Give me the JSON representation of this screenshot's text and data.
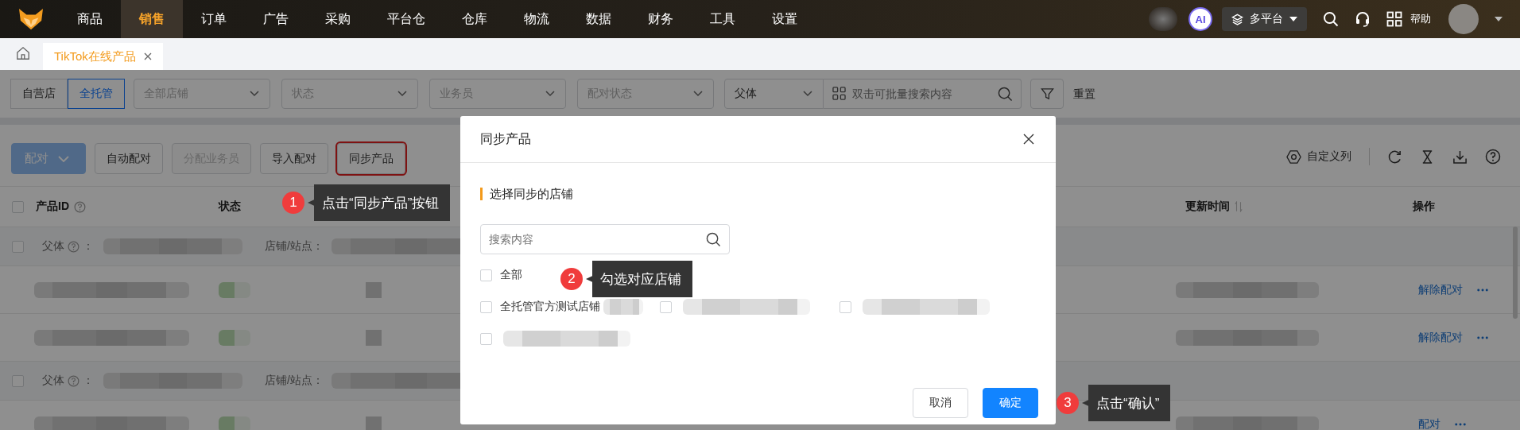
{
  "top_nav": {
    "items": [
      {
        "label": "商品",
        "selected": false
      },
      {
        "label": "销售",
        "selected": true
      },
      {
        "label": "订单",
        "selected": false
      },
      {
        "label": "广告",
        "selected": false
      },
      {
        "label": "采购",
        "selected": false
      },
      {
        "label": "平台仓",
        "selected": false
      },
      {
        "label": "仓库",
        "selected": false
      },
      {
        "label": "物流",
        "selected": false
      },
      {
        "label": "数据",
        "selected": false
      },
      {
        "label": "财务",
        "selected": false
      },
      {
        "label": "工具",
        "selected": false
      },
      {
        "label": "设置",
        "selected": false
      }
    ],
    "ai_badge": "AI",
    "platform": "多平台",
    "help": "帮助"
  },
  "tabs": [
    {
      "label": "TikTok在线产品",
      "selected": true
    }
  ],
  "filters": {
    "segments": [
      {
        "label": "自营店",
        "selected": false
      },
      {
        "label": "全托管",
        "selected": true
      }
    ],
    "selects": [
      {
        "placeholder": "全部店铺"
      },
      {
        "placeholder": "状态"
      },
      {
        "placeholder": "业务员"
      },
      {
        "placeholder": "配对状态"
      }
    ],
    "search_type": "父体",
    "search": {
      "placeholder": "双击可批量搜索内容"
    },
    "reset": "重置"
  },
  "toolbar": {
    "buttons": [
      {
        "label": "配对",
        "kind": "primary",
        "disabled": true,
        "highlighted": false
      },
      {
        "label": "自动配对",
        "kind": "default",
        "disabled": false,
        "highlighted": false
      },
      {
        "label": "分配业务员",
        "kind": "default",
        "disabled": true,
        "highlighted": false
      },
      {
        "label": "导入配对",
        "kind": "default",
        "disabled": false,
        "highlighted": false
      },
      {
        "label": "同步产品",
        "kind": "default",
        "disabled": false,
        "highlighted": true
      }
    ],
    "custom_columns": "自定义列"
  },
  "table": {
    "all_checked": false,
    "columns": [
      {
        "label": "产品ID",
        "kind": "help"
      },
      {
        "label": "状态",
        "kind": "plain"
      },
      {
        "label": "更新时间",
        "kind": "sortable"
      },
      {
        "label": "操作",
        "kind": "plain"
      }
    ],
    "rows": [
      {
        "kind": "parent",
        "checked": false,
        "label": "父体",
        "suffix": "：",
        "store_label": "店铺/站点："
      },
      {
        "kind": "child",
        "action": "解除配对"
      },
      {
        "kind": "child",
        "action": "解除配对"
      },
      {
        "kind": "parent",
        "checked": false,
        "label": "父体",
        "suffix": "：",
        "store_label": "店铺/站点："
      },
      {
        "kind": "child",
        "action": "配对"
      }
    ]
  },
  "modal": {
    "title": "同步产品",
    "section_title": "选择同步的店铺",
    "search": {
      "placeholder": "搜索内容"
    },
    "select_all": {
      "label": "全部",
      "checked": false
    },
    "stores": [
      {
        "label": "全托管官方测试店铺",
        "checked": false
      },
      {
        "checked": false
      },
      {
        "checked": false
      },
      {
        "checked": false
      }
    ],
    "buttons": [
      {
        "label": "取消",
        "kind": "default"
      },
      {
        "label": "确定",
        "kind": "primary"
      }
    ]
  },
  "callouts": [
    {
      "number": "1",
      "text": "点击“同步产品”按钮"
    },
    {
      "number": "2",
      "text": "勾选对应店铺"
    },
    {
      "number": "3",
      "text": "点击“确认”"
    }
  ]
}
